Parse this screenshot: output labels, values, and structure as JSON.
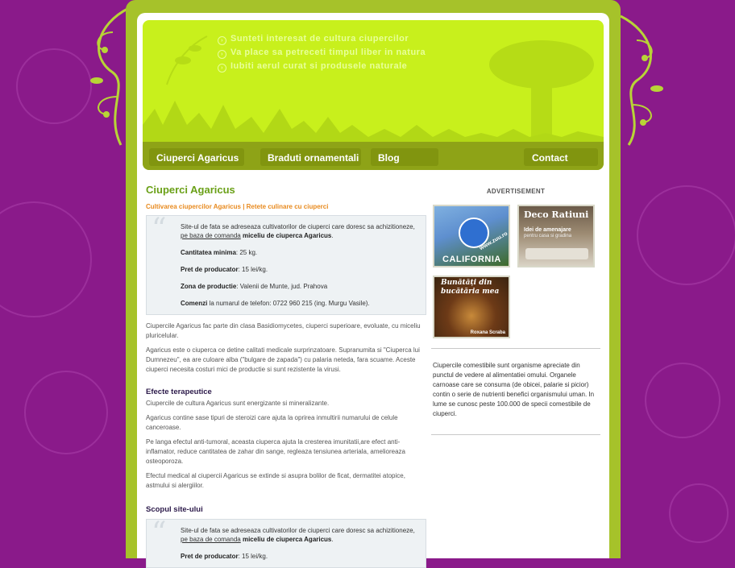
{
  "header": {
    "taglines": [
      "Sunteti interesat de cultura ciupercilor",
      "Va place sa petreceti timpul liber in natura",
      "Iubiti aerul curat si produsele naturale"
    ]
  },
  "nav": {
    "items": [
      "Ciuperci Agaricus",
      "Braduti ornamentali",
      "Blog"
    ],
    "contact": "Contact"
  },
  "main": {
    "title": "Ciuperci Agaricus",
    "subtitle": "Cultivarea ciupercilor Agaricus | Retete culinare cu ciuperci",
    "box1": {
      "intro_a": "Site-ul de fata se adreseaza cultivatorilor de ciuperci care doresc sa achizitioneze,",
      "intro_link": "pe baza de comanda",
      "intro_b": "miceliu de ciuperca Agaricus",
      "intro_end": ".",
      "qty_label": "Cantitatea minima",
      "qty_value": ": 25 kg.",
      "price_label": "Pret de producator",
      "price_value": ": 15 lei/kg.",
      "zone_label": "Zona de productie",
      "zone_value": ": Valenii de Munte, jud. Prahova",
      "order_label": "Comenzi",
      "order_value": " la numarul de telefon: 0722 960 215 (ing. Murgu Vasile)."
    },
    "para1": "Ciupercile Agaricus fac parte din clasa Basidiomycetes, ciuperci superioare, evoluate, cu miceliu pluricelular.",
    "para2": "Agaricus este o ciuperca ce detine calitati medicale surprinzatoare. Supranumita si \"Ciuperca lui Dumnezeu\", ea are culoare alba (\"bulgare de zapada\") cu palaria neteda, fara scuame. Aceste ciuperci necesita costuri mici de productie si sunt rezistente la virusi.",
    "h_effects": "Efecte terapeutice",
    "eff1": "Ciupercile de cultura Agaricus sunt energizante si mineralizante.",
    "eff2": "Agaricus contine sase tipuri de steroizi care ajuta la oprirea inmultirii numarului de celule canceroase.",
    "eff3": "Pe langa efectul anti-tumoral, aceasta ciuperca ajuta la cresterea imunitatii,are efect anti-inflamator, reduce cantitatea de zahar din sange, regleaza tensiunea arteriala, amelioreaza osteoporoza.",
    "eff4": "Efectul medical al ciupercii Agaricus se extinde si asupra bolilor de ficat, dermatitei atopice, astmului si alergiilor.",
    "h_purpose": "Scopul site-ului",
    "box2": {
      "intro_a": "Site-ul de fata se adreseaza cultivatorilor de ciuperci care doresc sa achizitioneze,",
      "intro_link": "pe baza de comanda",
      "intro_b": "miceliu de ciuperca Agaricus",
      "intro_end": ".",
      "price_label": "Pret de producator",
      "price_value": ": 15 lei/kg."
    }
  },
  "sidebar": {
    "ad_title": "ADVERTISEMENT",
    "ads": {
      "california": {
        "label": "CALIFORNIA",
        "url_text": "www.zuu.ro"
      },
      "deco": {
        "title": "Deco Ratiuni",
        "line1": "Idei de amenajare",
        "line2": "pentru casa si gradina"
      },
      "bucatarie": {
        "title": "Bunătăți din bucătăria mea",
        "author": "Roxana Scraba"
      }
    },
    "text": "Ciupercile comestibile sunt organisme apreciate din punctul de vedere al alimentatiei omului. Organele carnoase care se consuma (de obicei, palarie si picior) contin o serie de nutrienti benefici organismului uman. In lume se cunosc peste 100.000 de specii comestibile de ciuperci."
  },
  "colors": {
    "background": "#8a1a8a",
    "frame": "#a6c22a",
    "header": "#c8f01c",
    "navbar": "#8ea317",
    "title_green": "#6aa017",
    "subtitle_orange": "#e88a1e"
  }
}
